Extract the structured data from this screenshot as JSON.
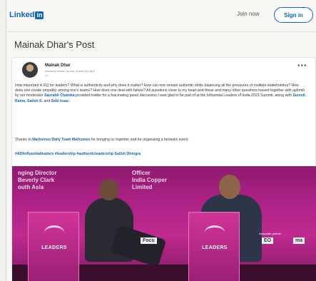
{
  "header": {
    "logo_text": "Linked",
    "logo_in": "in",
    "join_label": "Join now",
    "signin_label": "Sign in"
  },
  "page": {
    "title": "Mainak Dhar's Post"
  },
  "post": {
    "author_name": "Mainak Dhar",
    "author_headline": "Business leader by day, author by night",
    "time": "1d",
    "body_parts": [
      "How important is EQ for leaders? What is authenticity and why does it matter? How can one remain authentic while balancing all the pressures of multiple stakeholders? How does one create empathy among one's teams? How does one deal with failure? All questions close to my heart and these and many other questions tossed together with aplomb by our moderator ",
      "Saurabh Chamba",
      " provided fodder for a fascinating panel discussion I was glad to be part of at the Influential Leaders of India 2023 Summit, along with ",
      "Suresh Raina",
      ", ",
      "Satish S.",
      " and ",
      "Sebi Issac",
      "."
    ],
    "thanks_parts": [
      "Thanks to ",
      "Marksmen Daily Team Marksmen",
      " for bringing us together and for organizing a fantastic event."
    ],
    "hashtags": "#ADIinfluentialleaders #leadership #authenticleadership Satish Dhingra"
  },
  "image": {
    "banner_left_line1": "nging Director",
    "banner_left_line2": "Beverly Clark",
    "banner_left_line3": "outh Asia",
    "banner_right_line1": "Officer",
    "banner_right_line2": "India Copper",
    "banner_right_line3": "Limited",
    "podium_text": "LEADERS",
    "sponsor_1": "Focu",
    "sponsor_2": "EO",
    "sponsor_3": "ma",
    "sponsor_label": "Associate partner"
  },
  "colors": {
    "accent": "#0a66c2",
    "image_magenta": "#b1238a"
  },
  "icons": {
    "more": "ellipsis-icon"
  }
}
